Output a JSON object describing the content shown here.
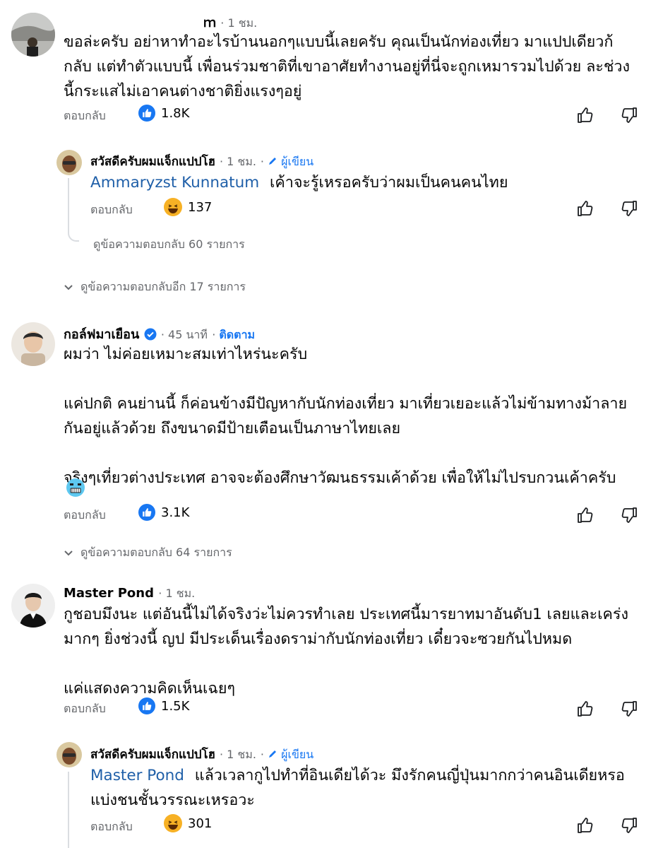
{
  "comments": [
    {
      "name": "ｍ",
      "time": "1 ชม.",
      "lines": [
        "ขอล่ะครับ อย่าหาทำอะไรบ้านนอกๆแบบนี้เลยครับ คุณเป็นนักท่องเที่ยว มาแปปเดียวก้",
        "กลับ แต่ทำตัวแบบนี้ เพื่อนร่วมชาติที่เขาอาศัยทำงานอยู่ที่นี่จะถูกเหมารวมไปด้วย ละช่วง",
        "นี้กระแสไม่เอาคนต่างชาติยิ่งแรงๆอยู่"
      ],
      "reply_label": "ตอบกลับ",
      "reaction_count": "1.8K",
      "reply": {
        "name": "สวัสดีครับผมแจ็กแปปโฮ",
        "time": "1 ชม.",
        "author_badge": "ผู้เขียน",
        "mention": "Ammaryzst Kunnatum",
        "text": "เค้าจะรู้เหรอครับว่าผมเป็นคนคนไทย",
        "reply_label": "ตอบกลับ",
        "reaction_count": "137",
        "view_replies": "ดูข้อความตอบกลับ 60 รายการ"
      },
      "view_more": "ดูข้อความตอบกลับอีก 17 รายการ"
    },
    {
      "name": "กอล์ฟมาเยือน",
      "time": "45 นาที",
      "follow": "ติดตาม",
      "lines": [
        "ผมว่า ไม่ค่อยเหมาะสมเท่าไหร่นะครับ",
        "",
        "แค่ปกติ คนย่านนี้ ก็ค่อนข้างมีปัญหากับนักท่องเที่ยว มาเที่ยวเยอะแล้วไม่ข้ามทางม้าลาย",
        "กันอยู่แล้วด้วย ถึงขนาดมีป้ายเตือนเป็นภาษาไทยเลย",
        "",
        "จริงๆเที่ยวต่างประเทศ อาจจะต้องศึกษาวัฒนธรรมเค้าด้วย เพื่อให้ไม่ไปรบกวนเค้าครับ"
      ],
      "emoji": "cold-face",
      "reply_label": "ตอบกลับ",
      "reaction_count": "3.1K",
      "view_replies": "ดูข้อความตอบกลับ 64 รายการ"
    },
    {
      "name": "Master Pond",
      "time": "1 ชม.",
      "lines": [
        "กูชอบมึงนะ แต่อันนี้ไม่ได้จริงว่ะไม่ควรทำเลย ประเทศนี้มารยาทมาอันดับ1 เลยและเคร่ง",
        "มากๆ ยิ่งช่วงนี้ ญป มีประเด็นเรื่องดราม่ากับนักท่องเที่ยว เดี๋ยวจะซวยกันไปหมด",
        "",
        "แค่แสดงความคิดเห็นเฉยๆ"
      ],
      "reply_label": "ตอบกลับ",
      "reaction_count": "1.5K",
      "reply": {
        "name": "สวัสดีครับผมแจ็กแปปโฮ",
        "time": "1 ชม.",
        "author_badge": "ผู้เขียน",
        "mention": "Master Pond",
        "text": "แล้วเวลากูไปทำที่อินเดียได้วะ มึงรักคนญี่ปุ่นมากกว่าคนอินเดียหรอ",
        "text2": "แบ่งชนชั้นวรรณะเหรอวะ",
        "reply_label": "ตอบกลับ",
        "reaction_count": "301"
      }
    }
  ],
  "colors": {
    "link": "#1877f2",
    "meta": "#65676b",
    "text": "#050505"
  },
  "icons": [
    "like-badge-icon",
    "haha-badge-icon",
    "thumbs-up-icon",
    "thumbs-down-icon",
    "verified-badge-icon",
    "pencil-icon",
    "chevron-down-icon"
  ]
}
